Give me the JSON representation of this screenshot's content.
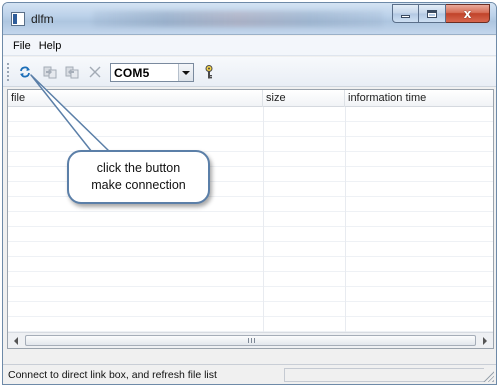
{
  "window": {
    "title": "dlfm",
    "caption_buttons": [
      "minimize-icon",
      "maximize-icon",
      "close-icon"
    ],
    "close_glyph": "x"
  },
  "menu": {
    "items": [
      "File",
      "Help"
    ]
  },
  "toolbar": {
    "buttons": [
      "refresh-connect-icon",
      "download-icon",
      "upload-icon",
      "delete-icon",
      "key-icon"
    ],
    "port": {
      "selected": "COM5"
    }
  },
  "list": {
    "columns": [
      "file",
      "size",
      "information time"
    ],
    "rows": []
  },
  "scrollbar": {
    "grip_glyph": "III"
  },
  "status": {
    "text": "Connect to direct link box, and refresh file list"
  },
  "callout": {
    "line1": "click the button",
    "line2": "make connection"
  },
  "colors": {
    "title_gradient": "#bcd2ea",
    "close_button": "#c0432a",
    "callout_border": "#5b7fa8",
    "refresh_arrow": "#1d6fb8"
  }
}
